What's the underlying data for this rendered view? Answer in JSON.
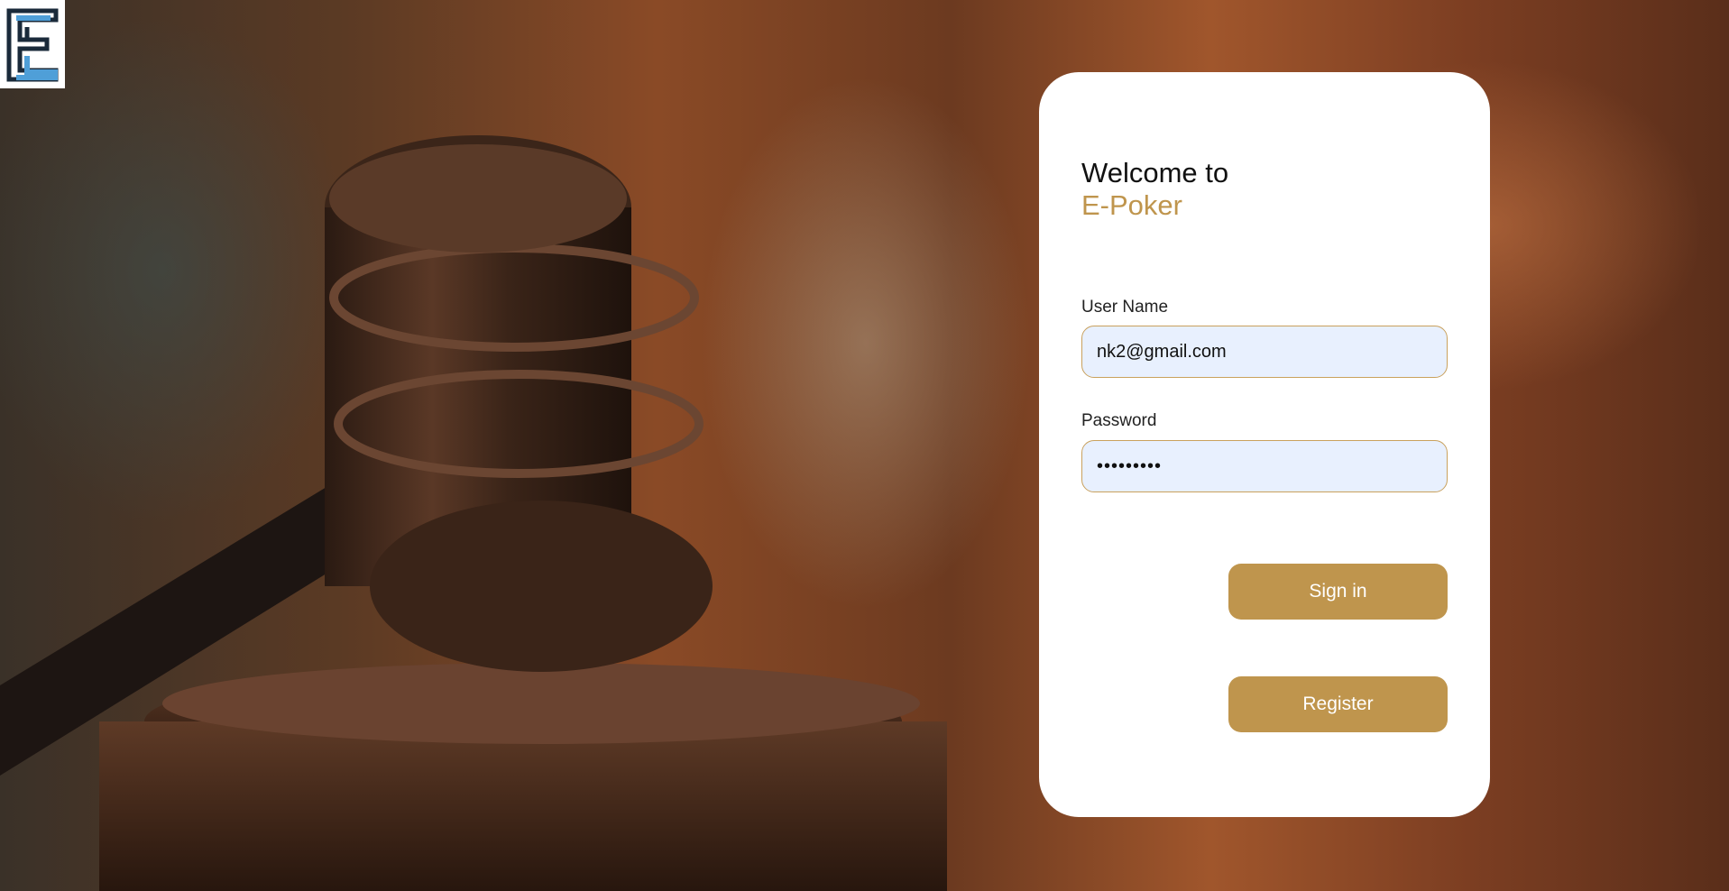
{
  "background": {
    "image": "gavel-and-scales-photo"
  },
  "logo": {
    "icon": "e-logo-icon",
    "colors": {
      "dark": "#1a2a3a",
      "light": "#4f9fd8"
    }
  },
  "login": {
    "welcome": "Welcome to",
    "brand": "E-Poker",
    "username_label": "User Name",
    "username_value": "nk2@gmail.com",
    "password_label": "Password",
    "password_value": "•••••••••",
    "signin_label": "Sign in",
    "register_label": "Register"
  },
  "colors": {
    "accent": "#bf954d",
    "input_bg": "#e8f0fe",
    "card_bg": "#ffffff"
  }
}
